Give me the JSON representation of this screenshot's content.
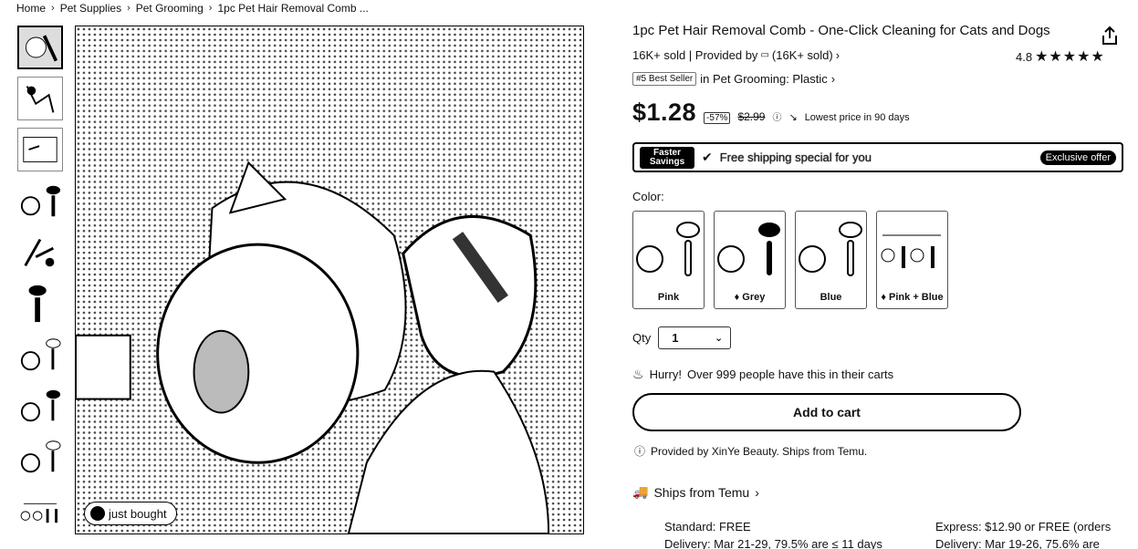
{
  "breadcrumb": {
    "items": [
      "Home",
      "Pet Supplies",
      "Pet Grooming",
      "1pc Pet Hair Removal Comb ..."
    ],
    "separator": "›"
  },
  "main_image": {
    "badge_text": "just bought"
  },
  "product": {
    "title": "1pc Pet Hair Removal Comb - One-Click Cleaning for Cats and Dogs",
    "sold_text": "16K+ sold | Provided by",
    "store_sold": "(16K+ sold)",
    "rating": "4.8",
    "stars": "★★★★★",
    "bestseller_badge": "#5 Best Seller",
    "bestseller_category": "in Pet Grooming: Plastic",
    "price": "$1.28",
    "discount": "-57%",
    "original_price": "$2.99",
    "lowest_price_note": "Lowest price in 90 days"
  },
  "banner": {
    "badge": "Faster Savings",
    "text": "Free shipping special for you",
    "exclusive": "Exclusive offer"
  },
  "color": {
    "label": "Color:",
    "options": [
      {
        "label": "Pink"
      },
      {
        "label": "Grey"
      },
      {
        "label": "Blue"
      },
      {
        "label": "Pink + Blue"
      }
    ]
  },
  "qty": {
    "label": "Qty",
    "value": "1"
  },
  "hurry": {
    "strong": "Hurry!",
    "text": "Over 999 people have this in their carts"
  },
  "cart": {
    "button": "Add to cart"
  },
  "provided_note": "Provided by XinYe Beauty. Ships from Temu.",
  "shipping": {
    "header": "Ships from Temu",
    "standard_line1": "Standard: FREE",
    "standard_line2": "Delivery: Mar 21-29, 79.5% are ≤ 11 days",
    "express_line1": "Express: $12.90 or FREE (orders",
    "express_line2": "Delivery: Mar 19-26, 75.6% are"
  }
}
